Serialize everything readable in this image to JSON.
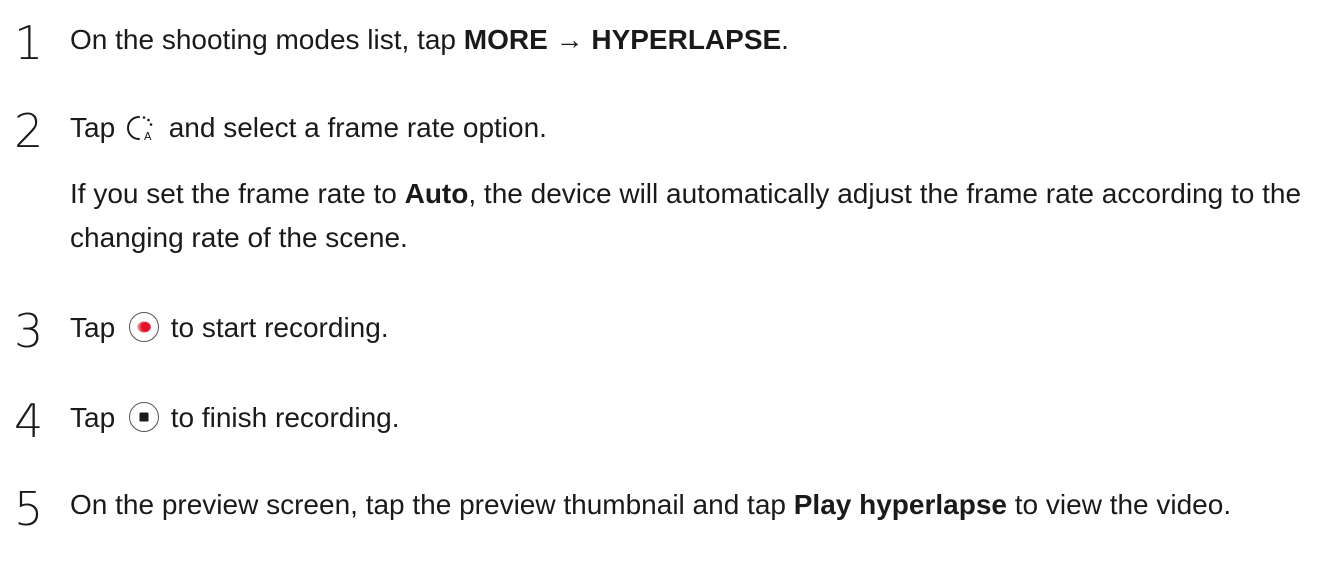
{
  "steps": [
    {
      "number": "1",
      "pre": "On the shooting modes list, tap ",
      "bold1": "MORE",
      "arrow": " → ",
      "bold2": "HYPERLAPSE",
      "post": "."
    },
    {
      "number": "2",
      "pre": "Tap ",
      "icon": "frame-rate-auto-icon",
      "post": " and select a frame rate option.",
      "note_pre": "If you set the frame rate to ",
      "note_bold": "Auto",
      "note_post": ", the device will automatically adjust the frame rate according to the changing rate of the scene."
    },
    {
      "number": "3",
      "pre": "Tap ",
      "icon": "record-button-icon",
      "post": " to start recording."
    },
    {
      "number": "4",
      "pre": "Tap ",
      "icon": "stop-button-icon",
      "post": " to finish recording."
    },
    {
      "number": "5",
      "pre": "On the preview screen, tap the preview thumbnail and tap ",
      "bold": "Play hyperlapse",
      "post": " to view the video."
    }
  ],
  "colors": {
    "text": "#1a1a1a",
    "record_red": "#e0142b"
  }
}
